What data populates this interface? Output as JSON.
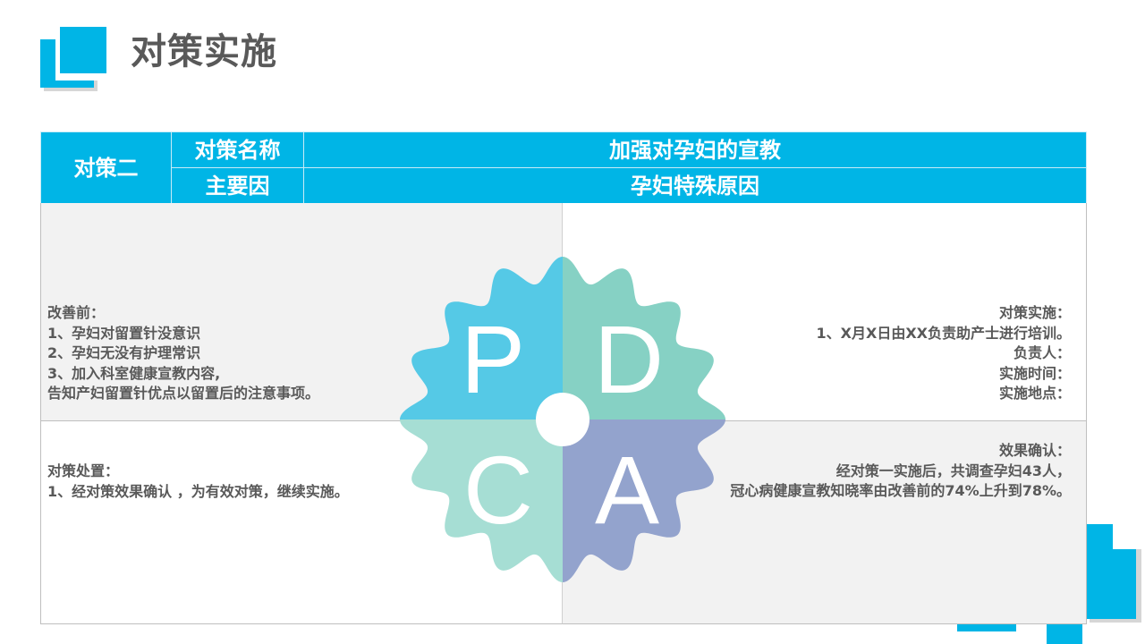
{
  "page": {
    "title": "对策实施"
  },
  "header_table": {
    "countermeasure_label": "对策二",
    "name_label": "对策名称",
    "name_value": "加强对孕妇的宣教",
    "cause_label": "主要因",
    "cause_value": "孕妇特殊原因"
  },
  "quadrants": {
    "before": {
      "lines": [
        "改善前：",
        "1、孕妇对留置针没意识",
        "2、孕妇无没有护理常识",
        "3、加入科室健康宣教内容,",
        "告知产妇留置针优点以留置后的注意事项。"
      ]
    },
    "implementation": {
      "lines": [
        "对策实施：",
        "1、X月X日由XX负责助产士进行培训。",
        "负责人：",
        "实施时间：",
        "实施地点："
      ]
    },
    "disposal": {
      "lines": [
        "对策处置：",
        "1、经对策效果确认 ，为有效对策，继续实施。"
      ]
    },
    "effect": {
      "lines": [
        "效果确认：",
        "经对策一实施后，共调查孕妇43人，",
        "冠心病健康宣教知晓率由改善前的74%上升到78%。"
      ]
    }
  },
  "pdca": {
    "letters": [
      "P",
      "D",
      "C",
      "A"
    ],
    "colors": {
      "P": "#55c9e6",
      "D": "#86d1c4",
      "C": "#a6ded4",
      "A": "#93a3cd"
    }
  },
  "colors": {
    "accent": "#00b5e6",
    "title_text": "#595959",
    "body_text": "#595959",
    "panel_gray": "#f2f2f2"
  }
}
